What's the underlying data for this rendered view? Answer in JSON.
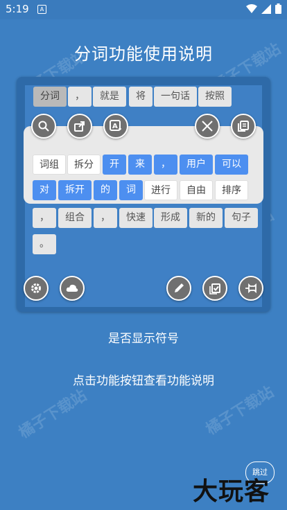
{
  "status_bar": {
    "time": "5:19",
    "notification_icon": "A"
  },
  "page": {
    "title": "分词功能使用说明"
  },
  "chips_top": [
    {
      "label": "分词",
      "style": "gray sel"
    },
    {
      "label": "，",
      "style": "light"
    },
    {
      "label": "就是",
      "style": "light"
    },
    {
      "label": "将",
      "style": "light"
    },
    {
      "label": "一句话",
      "style": "light"
    },
    {
      "label": "按照",
      "style": "light"
    }
  ],
  "chips_row1": [
    {
      "label": "词组",
      "style": "white"
    },
    {
      "label": "拆分",
      "style": "white"
    },
    {
      "label": "开",
      "style": "blue"
    },
    {
      "label": "来",
      "style": "blue"
    },
    {
      "label": "，",
      "style": "blue"
    },
    {
      "label": "用户",
      "style": "blue"
    },
    {
      "label": "可以",
      "style": "blue"
    }
  ],
  "chips_row2": [
    {
      "label": "对",
      "style": "blue"
    },
    {
      "label": "拆开",
      "style": "blue"
    },
    {
      "label": "的",
      "style": "blue"
    },
    {
      "label": "词",
      "style": "blue"
    },
    {
      "label": "进行",
      "style": "white"
    },
    {
      "label": "自由",
      "style": "white"
    },
    {
      "label": "排序",
      "style": "white"
    }
  ],
  "chips_row3": [
    {
      "label": "，",
      "style": "light"
    },
    {
      "label": "组合",
      "style": "light"
    },
    {
      "label": "，",
      "style": "light"
    },
    {
      "label": "快速",
      "style": "light"
    },
    {
      "label": "形成",
      "style": "light"
    },
    {
      "label": "新的",
      "style": "light"
    },
    {
      "label": "句子",
      "style": "light"
    }
  ],
  "chips_row4": [
    {
      "label": "。",
      "style": "light"
    }
  ],
  "captions": {
    "symbols": "是否显示符号",
    "hint": "点击功能按钮查看功能说明"
  },
  "skip_label": "跳过",
  "watermark": "橘子下载站",
  "brand": "大玩客",
  "colors": {
    "background": "#3d80c3",
    "accent_blue": "#4d8ff0",
    "button_gray": "#707070"
  }
}
